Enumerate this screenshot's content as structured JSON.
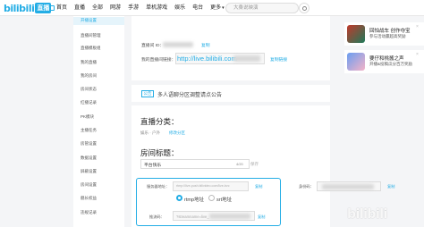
{
  "header": {
    "logo_text": "bilibili",
    "logo_badge": "直播",
    "nav": [
      "首页",
      "直播",
      "全部",
      "网游",
      "手游",
      "单机游戏",
      "娱乐",
      "电台",
      "更多"
    ],
    "search_placeholder": "大桑说映演"
  },
  "sidebar": {
    "items": [
      "开播设置",
      "直播间管理",
      "直播模板组",
      "我的直播",
      "我的房间",
      "房间状态",
      "红播记录",
      "PK模块",
      "主播任务",
      "房管设置",
      "数据设置",
      "屏蔽设置",
      "房间设置",
      "舰长权益",
      "违规记录"
    ]
  },
  "room_info": {
    "room_id_label": "直播间 ID：",
    "room_id_link": "复制",
    "room_link_label": "我的直播间链接：",
    "room_link_value": "http://live.bilibili.com",
    "room_link_action": "复制链接"
  },
  "notice": {
    "tag": "公告",
    "text": "多人语聊分区调整请点公告"
  },
  "category": {
    "title": "直播分类：",
    "current_label": "娱乐 · 户外",
    "change_link": "修改分区"
  },
  "room_title": {
    "title": "房间标题：",
    "value": "平台快乐",
    "count": "4/20",
    "save": "保存"
  },
  "push": {
    "server_label": "服务器地址：",
    "server_value": "rtmp://live-push.bilivideo.com/live-bvc",
    "server_copy": "复制",
    "key_label": "推流码：",
    "key_value": "?streamname=live_",
    "key_copy": "复制",
    "side_label": "身份码：",
    "side_copy": "复制",
    "radio_rtmp": "rtmp地址",
    "radio_srt": "srt地址",
    "selected": "rtmp"
  },
  "promos": [
    {
      "title": "回怕战车 创作夺宝",
      "sub": "参与活动赢超高奖励",
      "close": "×"
    },
    {
      "title": "要仔和桃酱之声",
      "sub": "开播&投稿瓜分百万奖励",
      "close": "×"
    }
  ],
  "watermark": "bilibili",
  "watermark_sub": "teszen"
}
